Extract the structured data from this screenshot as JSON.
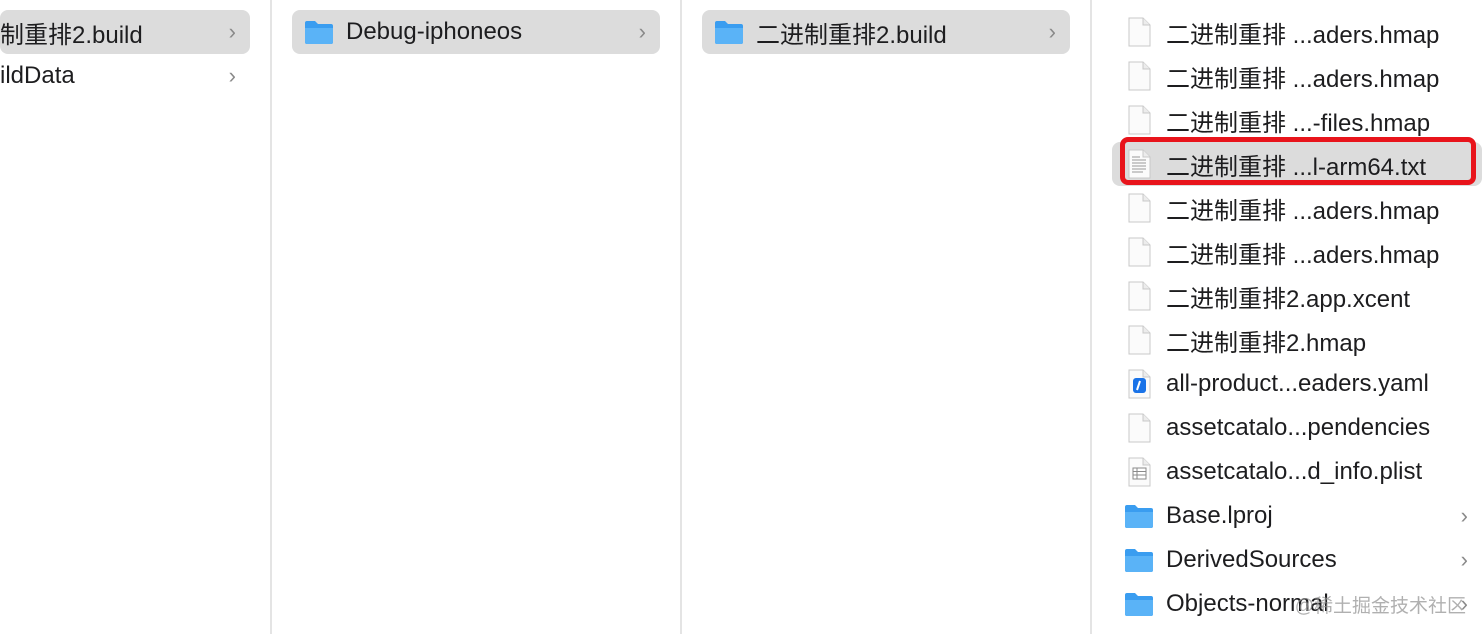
{
  "colors": {
    "selection": "#dcdcdc",
    "folder": "#3a9df0",
    "highlight": "#e8141b",
    "chevron": "#8a8a8a"
  },
  "columns": [
    {
      "items": [
        {
          "label": "制重排2.build",
          "icon": "none",
          "chevron": "›",
          "selected": true
        },
        {
          "label": "ildData",
          "icon": "none",
          "chevron": "›",
          "selected": false
        }
      ]
    },
    {
      "items": [
        {
          "label": "Debug-iphoneos",
          "icon": "folder-icon",
          "chevron": "›",
          "selected": true
        }
      ]
    },
    {
      "items": [
        {
          "label": "二进制重排2.build",
          "icon": "folder-icon",
          "chevron": "›",
          "selected": true
        }
      ]
    },
    {
      "items": [
        {
          "label": "二进制重排 ...aders.hmap",
          "icon": "document-icon"
        },
        {
          "label": "二进制重排 ...aders.hmap",
          "icon": "document-icon"
        },
        {
          "label": "二进制重排 ...-files.hmap",
          "icon": "document-icon"
        },
        {
          "label": "二进制重排 ...l-arm64.txt",
          "icon": "text-file-icon",
          "selected": true
        },
        {
          "label": "二进制重排 ...aders.hmap",
          "icon": "document-icon"
        },
        {
          "label": "二进制重排 ...aders.hmap",
          "icon": "document-icon"
        },
        {
          "label": "二进制重排2.app.xcent",
          "icon": "document-icon"
        },
        {
          "label": "二进制重排2.hmap",
          "icon": "document-icon"
        },
        {
          "label": "all-product...eaders.yaml",
          "icon": "yaml-file-icon"
        },
        {
          "label": "assetcatalo...pendencies",
          "icon": "document-icon"
        },
        {
          "label": "assetcatalo...d_info.plist",
          "icon": "plist-file-icon"
        },
        {
          "label": "Base.lproj",
          "icon": "folder-icon",
          "chevron": "›"
        },
        {
          "label": "DerivedSources",
          "icon": "folder-icon",
          "chevron": "›"
        },
        {
          "label": "Objects-normal",
          "icon": "folder-icon",
          "chevron": "›"
        }
      ]
    }
  ],
  "watermark": "@稀土掘金技术社区"
}
